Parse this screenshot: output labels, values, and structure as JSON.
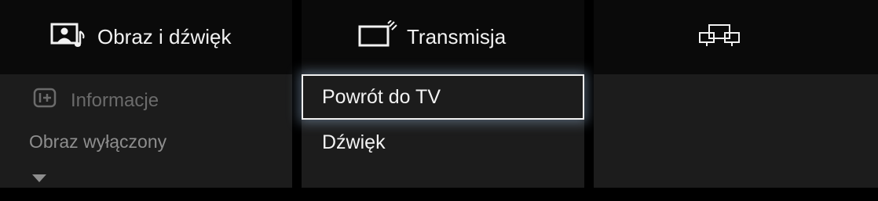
{
  "panels": {
    "picture_sound": {
      "title": "Obraz i dźwięk",
      "icon": "picture-sound-icon",
      "info_label": "Informacje",
      "info_icon": "info-plus-icon",
      "status": "Obraz wyłączony"
    },
    "broadcast": {
      "title": "Transmisja",
      "icon": "tv-broadcast-icon",
      "items": [
        {
          "label": "Powrót do TV",
          "selected": true
        },
        {
          "label": "Dźwięk",
          "selected": false
        }
      ]
    },
    "third": {
      "icon": "multi-screen-icon"
    }
  },
  "colors": {
    "background": "#000000",
    "panel": "#1c1c1c",
    "header": "#0a0a0a",
    "text": "#f2f2f2",
    "dim_text": "#6b6b6b",
    "focus_border": "#f0f0f0"
  }
}
